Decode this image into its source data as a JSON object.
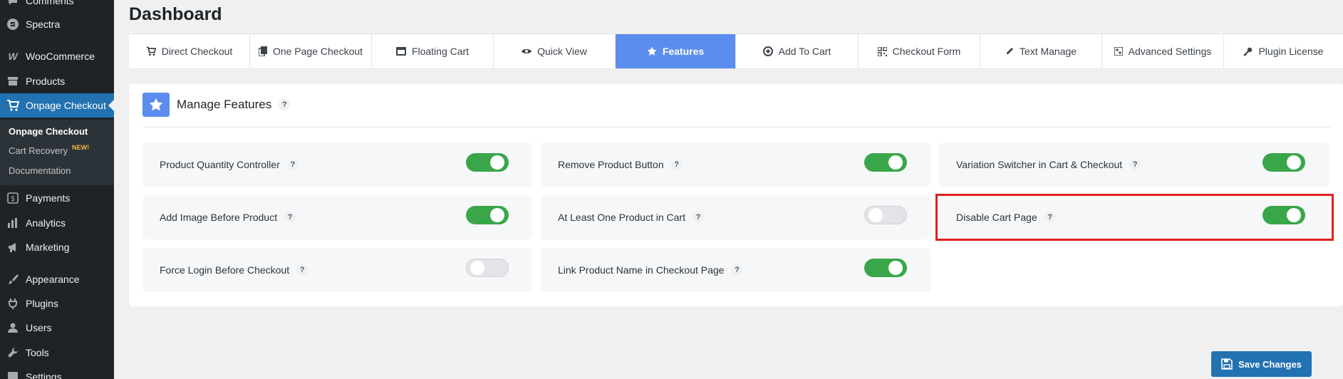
{
  "sidebar": {
    "items": [
      {
        "label": "Comments",
        "icon": "comment-icon"
      },
      {
        "label": "Spectra",
        "icon": "spectra-icon"
      },
      {
        "label": "WooCommerce",
        "icon": "woocommerce-icon"
      },
      {
        "label": "Products",
        "icon": "archive-icon"
      },
      {
        "label": "Onpage Checkout",
        "icon": "cart-icon"
      },
      {
        "label": "Payments",
        "icon": "dollar-icon"
      },
      {
        "label": "Analytics",
        "icon": "bar-chart-icon"
      },
      {
        "label": "Marketing",
        "icon": "megaphone-icon"
      },
      {
        "label": "Appearance",
        "icon": "brush-icon"
      },
      {
        "label": "Plugins",
        "icon": "plug-icon"
      },
      {
        "label": "Users",
        "icon": "user-icon"
      },
      {
        "label": "Tools",
        "icon": "wrench-icon"
      },
      {
        "label": "Settings",
        "icon": "sliders-icon"
      }
    ],
    "submenu": {
      "onpage_checkout": "Onpage Checkout",
      "cart_recovery": "Cart Recovery",
      "new_badge": "NEW!",
      "documentation": "Documentation"
    }
  },
  "page": {
    "title": "Dashboard"
  },
  "tabs": [
    {
      "label": "Direct Checkout",
      "icon": "cart-icon"
    },
    {
      "label": "One Page Checkout",
      "icon": "copy-icon"
    },
    {
      "label": "Floating Cart",
      "icon": "window-icon"
    },
    {
      "label": "Quick View",
      "icon": "eye-icon"
    },
    {
      "label": "Features",
      "icon": "star-icon",
      "active": true
    },
    {
      "label": "Add To Cart",
      "icon": "plus-circle-icon"
    },
    {
      "label": "Checkout Form",
      "icon": "qr-icon"
    },
    {
      "label": "Text Manage",
      "icon": "pencil-icon"
    },
    {
      "label": "Advanced Settings",
      "icon": "grid-icon"
    },
    {
      "label": "Plugin License",
      "icon": "key-icon"
    }
  ],
  "features_panel": {
    "title": "Manage Features",
    "help": "?",
    "features": [
      {
        "label": "Product Quantity Controller",
        "enabled": true
      },
      {
        "label": "Remove Product Button",
        "enabled": true
      },
      {
        "label": "Variation Switcher in Cart & Checkout",
        "enabled": true
      },
      {
        "label": "Add Image Before Product",
        "enabled": true
      },
      {
        "label": "At Least One Product in Cart",
        "enabled": false
      },
      {
        "label": "Disable Cart Page",
        "enabled": true
      },
      {
        "label": "Force Login Before Checkout",
        "enabled": false
      },
      {
        "label": "Link Product Name in Checkout Page",
        "enabled": true
      }
    ]
  },
  "actions": {
    "save_label": "Save Changes"
  },
  "colors": {
    "sidebar_bg": "#1d2327",
    "wp_blue": "#2271b1",
    "tab_active": "#5b8def",
    "toggle_on": "#3aa64a",
    "highlight": "#e0201e"
  }
}
